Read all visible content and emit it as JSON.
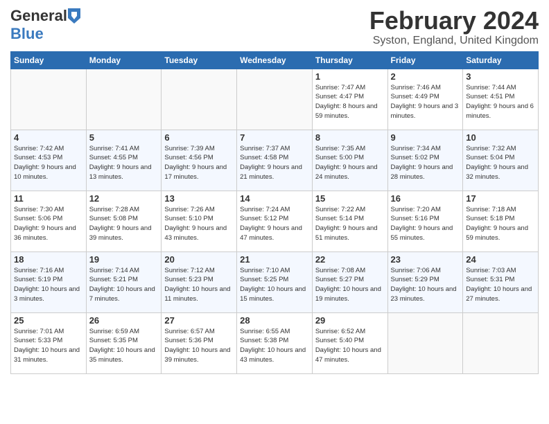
{
  "logo": {
    "general": "General",
    "blue": "Blue"
  },
  "header": {
    "title": "February 2024",
    "subtitle": "Syston, England, United Kingdom"
  },
  "weekdays": [
    "Sunday",
    "Monday",
    "Tuesday",
    "Wednesday",
    "Thursday",
    "Friday",
    "Saturday"
  ],
  "weeks": [
    [
      {
        "day": "",
        "empty": true
      },
      {
        "day": "",
        "empty": true
      },
      {
        "day": "",
        "empty": true
      },
      {
        "day": "",
        "empty": true
      },
      {
        "day": "1",
        "sunrise": "Sunrise: 7:47 AM",
        "sunset": "Sunset: 4:47 PM",
        "daylight": "Daylight: 8 hours and 59 minutes."
      },
      {
        "day": "2",
        "sunrise": "Sunrise: 7:46 AM",
        "sunset": "Sunset: 4:49 PM",
        "daylight": "Daylight: 9 hours and 3 minutes."
      },
      {
        "day": "3",
        "sunrise": "Sunrise: 7:44 AM",
        "sunset": "Sunset: 4:51 PM",
        "daylight": "Daylight: 9 hours and 6 minutes."
      }
    ],
    [
      {
        "day": "4",
        "sunrise": "Sunrise: 7:42 AM",
        "sunset": "Sunset: 4:53 PM",
        "daylight": "Daylight: 9 hours and 10 minutes."
      },
      {
        "day": "5",
        "sunrise": "Sunrise: 7:41 AM",
        "sunset": "Sunset: 4:55 PM",
        "daylight": "Daylight: 9 hours and 13 minutes."
      },
      {
        "day": "6",
        "sunrise": "Sunrise: 7:39 AM",
        "sunset": "Sunset: 4:56 PM",
        "daylight": "Daylight: 9 hours and 17 minutes."
      },
      {
        "day": "7",
        "sunrise": "Sunrise: 7:37 AM",
        "sunset": "Sunset: 4:58 PM",
        "daylight": "Daylight: 9 hours and 21 minutes."
      },
      {
        "day": "8",
        "sunrise": "Sunrise: 7:35 AM",
        "sunset": "Sunset: 5:00 PM",
        "daylight": "Daylight: 9 hours and 24 minutes."
      },
      {
        "day": "9",
        "sunrise": "Sunrise: 7:34 AM",
        "sunset": "Sunset: 5:02 PM",
        "daylight": "Daylight: 9 hours and 28 minutes."
      },
      {
        "day": "10",
        "sunrise": "Sunrise: 7:32 AM",
        "sunset": "Sunset: 5:04 PM",
        "daylight": "Daylight: 9 hours and 32 minutes."
      }
    ],
    [
      {
        "day": "11",
        "sunrise": "Sunrise: 7:30 AM",
        "sunset": "Sunset: 5:06 PM",
        "daylight": "Daylight: 9 hours and 36 minutes."
      },
      {
        "day": "12",
        "sunrise": "Sunrise: 7:28 AM",
        "sunset": "Sunset: 5:08 PM",
        "daylight": "Daylight: 9 hours and 39 minutes."
      },
      {
        "day": "13",
        "sunrise": "Sunrise: 7:26 AM",
        "sunset": "Sunset: 5:10 PM",
        "daylight": "Daylight: 9 hours and 43 minutes."
      },
      {
        "day": "14",
        "sunrise": "Sunrise: 7:24 AM",
        "sunset": "Sunset: 5:12 PM",
        "daylight": "Daylight: 9 hours and 47 minutes."
      },
      {
        "day": "15",
        "sunrise": "Sunrise: 7:22 AM",
        "sunset": "Sunset: 5:14 PM",
        "daylight": "Daylight: 9 hours and 51 minutes."
      },
      {
        "day": "16",
        "sunrise": "Sunrise: 7:20 AM",
        "sunset": "Sunset: 5:16 PM",
        "daylight": "Daylight: 9 hours and 55 minutes."
      },
      {
        "day": "17",
        "sunrise": "Sunrise: 7:18 AM",
        "sunset": "Sunset: 5:18 PM",
        "daylight": "Daylight: 9 hours and 59 minutes."
      }
    ],
    [
      {
        "day": "18",
        "sunrise": "Sunrise: 7:16 AM",
        "sunset": "Sunset: 5:19 PM",
        "daylight": "Daylight: 10 hours and 3 minutes."
      },
      {
        "day": "19",
        "sunrise": "Sunrise: 7:14 AM",
        "sunset": "Sunset: 5:21 PM",
        "daylight": "Daylight: 10 hours and 7 minutes."
      },
      {
        "day": "20",
        "sunrise": "Sunrise: 7:12 AM",
        "sunset": "Sunset: 5:23 PM",
        "daylight": "Daylight: 10 hours and 11 minutes."
      },
      {
        "day": "21",
        "sunrise": "Sunrise: 7:10 AM",
        "sunset": "Sunset: 5:25 PM",
        "daylight": "Daylight: 10 hours and 15 minutes."
      },
      {
        "day": "22",
        "sunrise": "Sunrise: 7:08 AM",
        "sunset": "Sunset: 5:27 PM",
        "daylight": "Daylight: 10 hours and 19 minutes."
      },
      {
        "day": "23",
        "sunrise": "Sunrise: 7:06 AM",
        "sunset": "Sunset: 5:29 PM",
        "daylight": "Daylight: 10 hours and 23 minutes."
      },
      {
        "day": "24",
        "sunrise": "Sunrise: 7:03 AM",
        "sunset": "Sunset: 5:31 PM",
        "daylight": "Daylight: 10 hours and 27 minutes."
      }
    ],
    [
      {
        "day": "25",
        "sunrise": "Sunrise: 7:01 AM",
        "sunset": "Sunset: 5:33 PM",
        "daylight": "Daylight: 10 hours and 31 minutes."
      },
      {
        "day": "26",
        "sunrise": "Sunrise: 6:59 AM",
        "sunset": "Sunset: 5:35 PM",
        "daylight": "Daylight: 10 hours and 35 minutes."
      },
      {
        "day": "27",
        "sunrise": "Sunrise: 6:57 AM",
        "sunset": "Sunset: 5:36 PM",
        "daylight": "Daylight: 10 hours and 39 minutes."
      },
      {
        "day": "28",
        "sunrise": "Sunrise: 6:55 AM",
        "sunset": "Sunset: 5:38 PM",
        "daylight": "Daylight: 10 hours and 43 minutes."
      },
      {
        "day": "29",
        "sunrise": "Sunrise: 6:52 AM",
        "sunset": "Sunset: 5:40 PM",
        "daylight": "Daylight: 10 hours and 47 minutes."
      },
      {
        "day": "",
        "empty": true
      },
      {
        "day": "",
        "empty": true
      }
    ]
  ]
}
